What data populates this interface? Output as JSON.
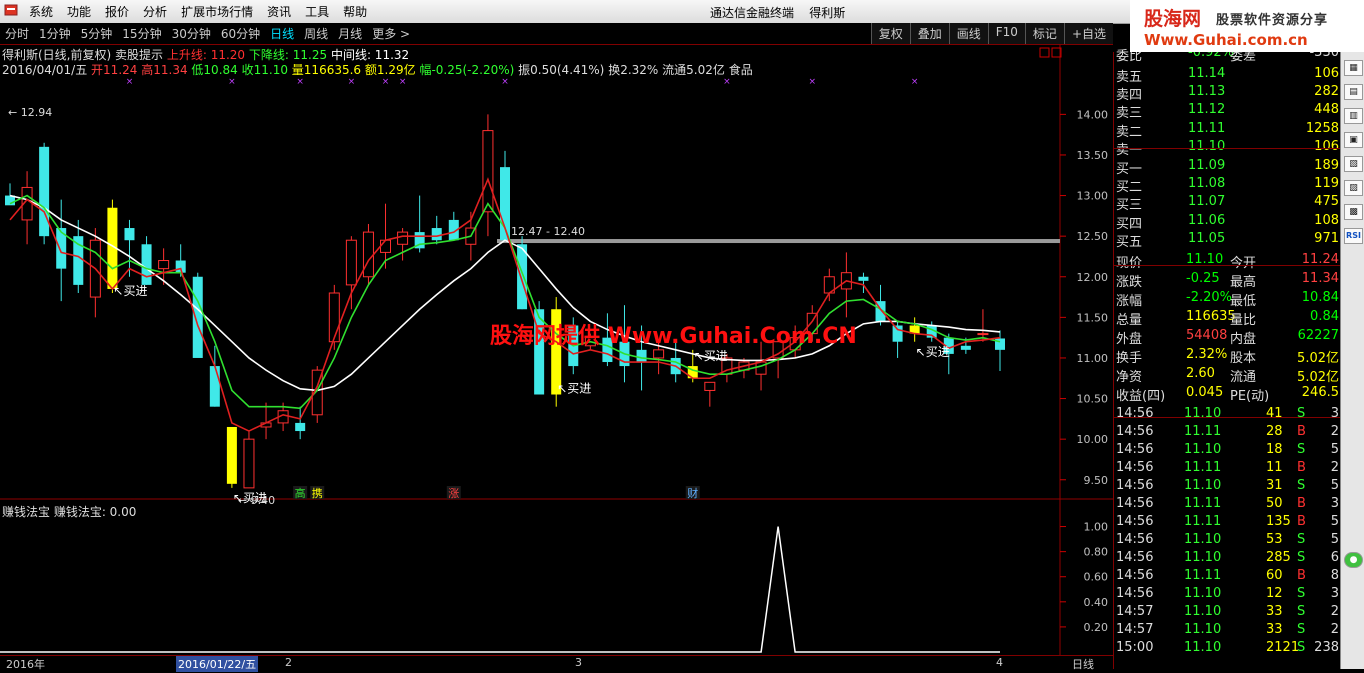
{
  "menu": {
    "items": [
      "系统",
      "功能",
      "报价",
      "分析",
      "扩展市场行情",
      "资讯",
      "工具",
      "帮助"
    ],
    "title": "通达信金融终端",
    "stock_name": "得利斯"
  },
  "logo": {
    "part1": "股海网",
    "part2": "股票软件资源分享",
    "url": "Www.Guhai.com.cn"
  },
  "periods": [
    "分时",
    "1分钟",
    "5分钟",
    "15分钟",
    "30分钟",
    "60分钟",
    "日线",
    "周线",
    "月线",
    "更多 >"
  ],
  "active_period": "日线",
  "tool_buttons": [
    "复权",
    "叠加",
    "画线",
    "F10",
    "标记",
    "+自选"
  ],
  "chart_header": {
    "name": "得利斯(日线,前复权)",
    "formula": "卖股提示",
    "up_line": "上升线: 11.20",
    "down_line": "下降线: 11.25",
    "mid_line": "中间线: 11.32",
    "date": "2016/04/01/五",
    "open": "开11.24",
    "high": "高11.34",
    "low": "低10.84",
    "close": "收11.10",
    "volume": "量116635.6",
    "amount": "额1.29亿",
    "change": "幅-0.25(-2.20%)",
    "amplitude": "振0.50(4.41%)",
    "turnover": "换2.32%",
    "float": "流通5.02亿",
    "industry": "食品"
  },
  "price_axis": [
    "14.00",
    "13.50",
    "13.00",
    "12.50",
    "12.00",
    "11.50",
    "11.00",
    "10.50",
    "10.00",
    "9.50"
  ],
  "annotations": {
    "high_label": "12.94",
    "range_label": "12.47 - 12.40",
    "low_label": "9.40",
    "buy": "买进",
    "tags": [
      "高",
      "携",
      "涨",
      "财"
    ]
  },
  "indicator": {
    "title": "赚钱法宝  赚钱法宝: 0.00",
    "axis": [
      "1.00",
      "0.80",
      "0.60",
      "0.40",
      "0.20"
    ]
  },
  "time_axis": {
    "year": "2016年",
    "cursor": "2016/01/22/五",
    "marks": [
      "2",
      "3",
      "4"
    ],
    "period_label": "日线"
  },
  "watermark": "股海网提供 Www.Guhai.Com.CN",
  "quote": {
    "order_ratio_label": "委比",
    "order_ratio": "-0.92%",
    "order_diff_label": "委差",
    "order_diff": "-330",
    "sells": [
      {
        "label": "卖五",
        "price": "11.14",
        "vol": "106"
      },
      {
        "label": "卖四",
        "price": "11.13",
        "vol": "282"
      },
      {
        "label": "卖三",
        "price": "11.12",
        "vol": "448"
      },
      {
        "label": "卖二",
        "price": "11.11",
        "vol": "1258"
      },
      {
        "label": "卖一",
        "price": "11.10",
        "vol": "106"
      }
    ],
    "buys": [
      {
        "label": "买一",
        "price": "11.09",
        "vol": "189"
      },
      {
        "label": "买二",
        "price": "11.08",
        "vol": "119"
      },
      {
        "label": "买三",
        "price": "11.07",
        "vol": "475"
      },
      {
        "label": "买四",
        "price": "11.06",
        "vol": "108"
      },
      {
        "label": "买五",
        "price": "11.05",
        "vol": "971"
      }
    ],
    "stats": [
      {
        "l1": "现价",
        "v1": "11.10",
        "c1": "#00ff00",
        "l2": "今开",
        "v2": "11.24",
        "c2": "#ff4040"
      },
      {
        "l1": "涨跌",
        "v1": "-0.25",
        "c1": "#00ff00",
        "l2": "最高",
        "v2": "11.34",
        "c2": "#ff4040"
      },
      {
        "l1": "涨幅",
        "v1": "-2.20%",
        "c1": "#00ff00",
        "l2": "最低",
        "v2": "10.84",
        "c2": "#00ff00"
      },
      {
        "l1": "总量",
        "v1": "116635",
        "c1": "#ffff00",
        "l2": "量比",
        "v2": "0.84",
        "c2": "#00ff00"
      },
      {
        "l1": "外盘",
        "v1": "54408",
        "c1": "#ff4040",
        "l2": "内盘",
        "v2": "62227",
        "c2": "#00ff00"
      },
      {
        "l1": "换手",
        "v1": "2.32%",
        "c1": "#ffff00",
        "l2": "股本",
        "v2": "5.02亿",
        "c2": "#ffff00"
      },
      {
        "l1": "净资",
        "v1": "2.60",
        "c1": "#ffff00",
        "l2": "流通",
        "v2": "5.02亿",
        "c2": "#ffff00"
      },
      {
        "l1": "收益(四)",
        "v1": "0.045",
        "c1": "#ffff00",
        "l2": "PE(动)",
        "v2": "246.5",
        "c2": "#ffff00"
      }
    ],
    "ticks": [
      {
        "time": "14:56",
        "price": "11.10",
        "vol": "41",
        "side": "S",
        "n": "3"
      },
      {
        "time": "14:56",
        "price": "11.11",
        "vol": "28",
        "side": "B",
        "n": "2"
      },
      {
        "time": "14:56",
        "price": "11.10",
        "vol": "18",
        "side": "S",
        "n": "5"
      },
      {
        "time": "14:56",
        "price": "11.11",
        "vol": "11",
        "side": "B",
        "n": "2"
      },
      {
        "time": "14:56",
        "price": "11.10",
        "vol": "31",
        "side": "S",
        "n": "5"
      },
      {
        "time": "14:56",
        "price": "11.11",
        "vol": "50",
        "side": "B",
        "n": "3"
      },
      {
        "time": "14:56",
        "price": "11.11",
        "vol": "135",
        "side": "B",
        "n": "5"
      },
      {
        "time": "14:56",
        "price": "11.10",
        "vol": "53",
        "side": "S",
        "n": "5"
      },
      {
        "time": "14:56",
        "price": "11.10",
        "vol": "285",
        "side": "S",
        "n": "6"
      },
      {
        "time": "14:56",
        "price": "11.11",
        "vol": "60",
        "side": "B",
        "n": "8"
      },
      {
        "time": "14:56",
        "price": "11.10",
        "vol": "12",
        "side": "S",
        "n": "3"
      },
      {
        "time": "14:57",
        "price": "11.10",
        "vol": "33",
        "side": "S",
        "n": "2"
      },
      {
        "time": "14:57",
        "price": "11.10",
        "vol": "33",
        "side": "S",
        "n": "2"
      },
      {
        "time": "15:00",
        "price": "11.10",
        "vol": "2121",
        "side": "S",
        "n": "238"
      }
    ]
  },
  "sidebar_icons": [
    "▦",
    "▤",
    "▥",
    "▣",
    "▧",
    "▨",
    "▩",
    "RSI",
    "●"
  ],
  "chart_data": {
    "type": "candlestick",
    "title": "得利斯(日线,前复权)",
    "ylim": [
      9.3,
      14.3
    ],
    "grid": false,
    "candles": [
      {
        "o": 13.0,
        "h": 13.15,
        "l": 12.9,
        "c": 12.88
      },
      {
        "o": 12.7,
        "h": 13.3,
        "l": 12.4,
        "c": 13.1
      },
      {
        "o": 13.6,
        "h": 13.65,
        "l": 12.4,
        "c": 12.5
      },
      {
        "o": 12.6,
        "h": 12.95,
        "l": 11.7,
        "c": 12.1
      },
      {
        "o": 12.5,
        "h": 12.7,
        "l": 11.8,
        "c": 11.9
      },
      {
        "o": 11.75,
        "h": 12.6,
        "l": 11.5,
        "c": 12.45
      },
      {
        "o": 12.85,
        "h": 12.95,
        "l": 11.8,
        "c": 11.85
      },
      {
        "o": 12.6,
        "h": 12.7,
        "l": 12.0,
        "c": 12.45
      },
      {
        "o": 12.4,
        "h": 12.5,
        "l": 11.9,
        "c": 11.9
      },
      {
        "o": 12.1,
        "h": 12.35,
        "l": 11.9,
        "c": 12.2
      },
      {
        "o": 12.2,
        "h": 12.4,
        "l": 12.0,
        "c": 12.05
      },
      {
        "o": 12.0,
        "h": 12.05,
        "l": 11.3,
        "c": 11.0
      },
      {
        "o": 10.9,
        "h": 11.15,
        "l": 10.4,
        "c": 10.4
      },
      {
        "o": 10.15,
        "h": 10.15,
        "l": 9.4,
        "c": 9.45
      },
      {
        "o": 9.4,
        "h": 10.1,
        "l": 9.4,
        "c": 10.0
      },
      {
        "o": 10.15,
        "h": 10.45,
        "l": 10.0,
        "c": 10.2
      },
      {
        "o": 10.2,
        "h": 10.45,
        "l": 10.1,
        "c": 10.35
      },
      {
        "o": 10.2,
        "h": 10.4,
        "l": 10.0,
        "c": 10.1
      },
      {
        "o": 10.3,
        "h": 10.9,
        "l": 10.2,
        "c": 10.85
      },
      {
        "o": 11.2,
        "h": 11.9,
        "l": 11.1,
        "c": 11.8
      },
      {
        "o": 11.9,
        "h": 12.5,
        "l": 11.6,
        "c": 12.45
      },
      {
        "o": 12.0,
        "h": 12.65,
        "l": 11.9,
        "c": 12.55
      },
      {
        "o": 12.3,
        "h": 12.9,
        "l": 12.1,
        "c": 12.45
      },
      {
        "o": 12.4,
        "h": 12.6,
        "l": 12.2,
        "c": 12.55
      },
      {
        "o": 12.55,
        "h": 13.0,
        "l": 12.3,
        "c": 12.35
      },
      {
        "o": 12.6,
        "h": 12.75,
        "l": 12.4,
        "c": 12.45
      },
      {
        "o": 12.7,
        "h": 12.8,
        "l": 12.5,
        "c": 12.45
      },
      {
        "o": 12.4,
        "h": 12.8,
        "l": 12.2,
        "c": 12.6
      },
      {
        "o": 12.8,
        "h": 14.0,
        "l": 12.5,
        "c": 13.8
      },
      {
        "o": 13.35,
        "h": 13.55,
        "l": 12.55,
        "c": 12.45
      },
      {
        "o": 12.4,
        "h": 12.5,
        "l": 11.6,
        "c": 11.6
      },
      {
        "o": 11.6,
        "h": 11.7,
        "l": 10.8,
        "c": 10.55
      },
      {
        "o": 11.6,
        "h": 11.75,
        "l": 10.4,
        "c": 10.55
      },
      {
        "o": 11.4,
        "h": 11.5,
        "l": 10.8,
        "c": 10.9
      },
      {
        "o": 11.15,
        "h": 11.3,
        "l": 11.1,
        "c": 11.25
      },
      {
        "o": 11.25,
        "h": 11.55,
        "l": 10.9,
        "c": 10.95
      },
      {
        "o": 11.2,
        "h": 11.65,
        "l": 10.7,
        "c": 10.9
      },
      {
        "o": 11.1,
        "h": 11.4,
        "l": 10.6,
        "c": 10.95
      },
      {
        "o": 11.0,
        "h": 11.2,
        "l": 10.8,
        "c": 11.1
      },
      {
        "o": 11.0,
        "h": 11.2,
        "l": 10.7,
        "c": 10.8
      },
      {
        "o": 10.9,
        "h": 11.1,
        "l": 10.7,
        "c": 10.75
      },
      {
        "o": 10.6,
        "h": 10.7,
        "l": 10.4,
        "c": 10.7
      },
      {
        "o": 10.8,
        "h": 11.05,
        "l": 10.7,
        "c": 11.0
      },
      {
        "o": 10.85,
        "h": 11.0,
        "l": 10.75,
        "c": 10.95
      },
      {
        "o": 10.8,
        "h": 11.2,
        "l": 10.6,
        "c": 10.95
      },
      {
        "o": 11.0,
        "h": 11.3,
        "l": 10.75,
        "c": 11.2
      },
      {
        "o": 11.1,
        "h": 11.4,
        "l": 11.0,
        "c": 11.25
      },
      {
        "o": 11.3,
        "h": 11.65,
        "l": 11.2,
        "c": 11.55
      },
      {
        "o": 11.8,
        "h": 12.1,
        "l": 11.7,
        "c": 12.0
      },
      {
        "o": 11.85,
        "h": 12.3,
        "l": 11.5,
        "c": 12.05
      },
      {
        "o": 12.0,
        "h": 12.05,
        "l": 11.8,
        "c": 11.95
      },
      {
        "o": 11.7,
        "h": 11.9,
        "l": 11.4,
        "c": 11.45
      },
      {
        "o": 11.4,
        "h": 11.45,
        "l": 11.0,
        "c": 11.2
      },
      {
        "o": 11.3,
        "h": 11.5,
        "l": 11.2,
        "c": 11.4
      },
      {
        "o": 11.4,
        "h": 11.45,
        "l": 11.2,
        "c": 11.25
      },
      {
        "o": 11.25,
        "h": 11.3,
        "l": 10.8,
        "c": 11.05
      },
      {
        "o": 11.15,
        "h": 11.25,
        "l": 11.05,
        "c": 11.1
      },
      {
        "o": 11.3,
        "h": 11.6,
        "l": 11.2,
        "c": 11.3
      },
      {
        "o": 11.24,
        "h": 11.34,
        "l": 10.84,
        "c": 11.1
      }
    ],
    "highlight_candles": [
      6,
      13,
      32,
      40,
      53
    ],
    "ma_white": [
      13.0,
      12.95,
      12.85,
      12.7,
      12.6,
      12.5,
      12.38,
      12.25,
      12.1,
      11.95,
      11.78,
      11.6,
      11.4,
      11.2,
      11.0,
      10.85,
      10.72,
      10.62,
      10.6,
      10.65,
      10.8,
      11.0,
      11.2,
      11.4,
      11.6,
      11.78,
      11.95,
      12.1,
      12.3,
      12.45,
      12.35,
      12.1,
      11.85,
      11.62,
      11.45,
      11.35,
      11.27,
      11.2,
      11.15,
      11.1,
      11.05,
      11.0,
      10.98,
      10.97,
      10.97,
      10.98,
      11.0,
      11.05,
      11.15,
      11.3,
      11.42,
      11.45,
      11.45,
      11.42,
      11.4,
      11.38,
      11.35,
      11.34,
      11.32
    ],
    "ma_green": [
      12.9,
      13.0,
      12.85,
      12.55,
      12.4,
      12.3,
      12.1,
      12.2,
      12.1,
      12.05,
      12.05,
      11.7,
      11.2,
      10.6,
      10.4,
      10.4,
      10.4,
      10.38,
      10.6,
      11.0,
      11.5,
      11.9,
      12.2,
      12.3,
      12.4,
      12.42,
      12.45,
      12.5,
      12.9,
      12.6,
      12.05,
      11.5,
      11.3,
      11.15,
      11.2,
      11.15,
      11.05,
      11.0,
      10.98,
      10.95,
      10.85,
      10.8,
      10.8,
      10.85,
      10.9,
      10.98,
      11.1,
      11.3,
      11.55,
      11.7,
      11.72,
      11.6,
      11.45,
      11.42,
      11.35,
      11.25,
      11.22,
      11.25,
      11.2
    ],
    "ma_red": [
      12.7,
      12.95,
      12.8,
      12.3,
      12.25,
      12.1,
      11.85,
      12.1,
      12.0,
      12.05,
      12.1,
      11.4,
      10.9,
      10.2,
      10.1,
      10.2,
      10.3,
      10.25,
      10.65,
      11.25,
      11.8,
      12.2,
      12.45,
      12.5,
      12.5,
      12.5,
      12.55,
      12.7,
      13.2,
      12.6,
      11.95,
      11.3,
      11.2,
      11.05,
      11.1,
      11.05,
      10.95,
      10.95,
      10.95,
      10.9,
      10.75,
      10.75,
      10.85,
      10.9,
      10.95,
      11.05,
      11.2,
      11.45,
      11.8,
      11.95,
      11.9,
      11.6,
      11.35,
      11.3,
      11.28,
      11.12,
      11.2,
      11.22,
      11.25
    ],
    "indicator_series": {
      "name": "赚钱法宝",
      "spike_index": 45,
      "spike_value": 1.0,
      "ylim": [
        0,
        1.1
      ]
    }
  }
}
